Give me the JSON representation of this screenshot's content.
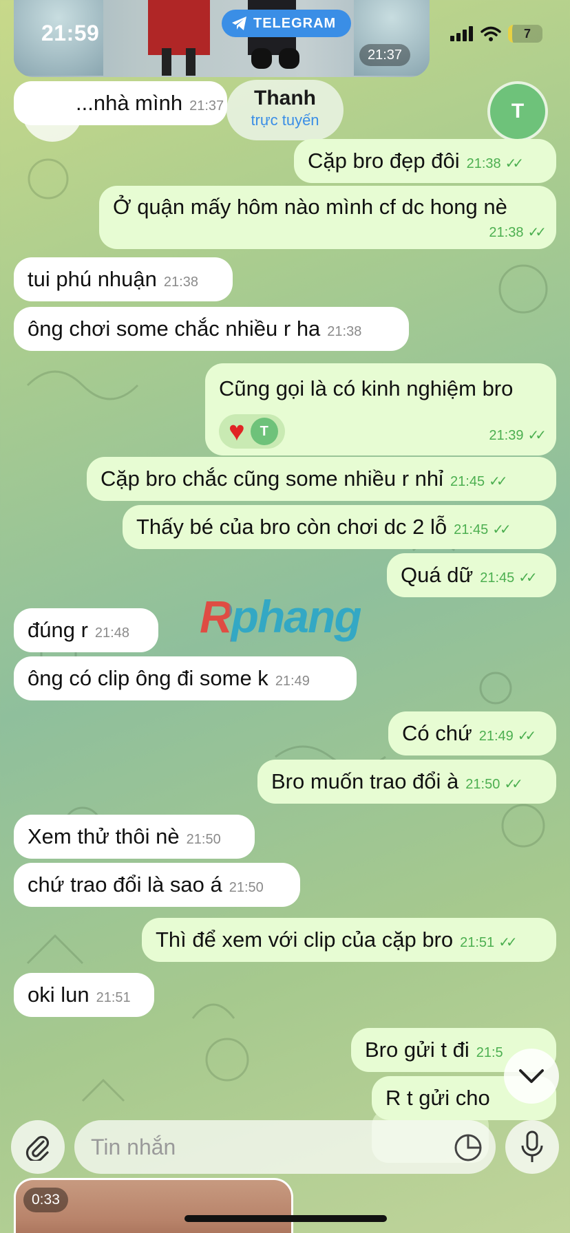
{
  "status_bar": {
    "time": "21:59",
    "app_pill": "TELEGRAM",
    "battery": "7"
  },
  "top_media": {
    "time": "21:37"
  },
  "header": {
    "name": "Thanh",
    "status": "trực tuyến",
    "avatar_initial": "T"
  },
  "messages": [
    {
      "dir": "in",
      "text": "...nhà mình",
      "time": "21:37"
    },
    {
      "dir": "out",
      "text": "Cặp bro đẹp đôi",
      "time": "21:38"
    },
    {
      "dir": "out",
      "text": "Ở quận mấy hôm nào mình cf dc hong nè",
      "time": "21:38"
    },
    {
      "dir": "in",
      "text": "tui phú nhuận",
      "time": "21:38"
    },
    {
      "dir": "in",
      "text": "ông chơi some chắc nhiều r ha",
      "time": "21:38"
    },
    {
      "dir": "out",
      "text": "Cũng gọi là có kinh nghiệm bro",
      "time": "21:39",
      "reaction_avatar": "T"
    },
    {
      "dir": "out",
      "text": "Cặp bro chắc cũng some nhiều r nhỉ",
      "time": "21:45"
    },
    {
      "dir": "out",
      "text": "Thấy bé của bro còn chơi dc 2 lỗ",
      "time": "21:45"
    },
    {
      "dir": "out",
      "text": "Quá dữ",
      "time": "21:45"
    },
    {
      "dir": "in",
      "text": "đúng r",
      "time": "21:48"
    },
    {
      "dir": "in",
      "text": "ông có clip ông đi some k",
      "time": "21:49"
    },
    {
      "dir": "out",
      "text": "Có chứ",
      "time": "21:49"
    },
    {
      "dir": "out",
      "text": "Bro muốn trao đổi à",
      "time": "21:50"
    },
    {
      "dir": "in",
      "text": "Xem thử thôi nè",
      "time": "21:50"
    },
    {
      "dir": "in",
      "text": "chứ trao đổi là sao á",
      "time": "21:50"
    },
    {
      "dir": "out",
      "text": "Thì để xem với clip của cặp bro",
      "time": "21:51"
    },
    {
      "dir": "in",
      "text": "oki lun",
      "time": "21:51"
    },
    {
      "dir": "out",
      "text": "Bro gửi t đi",
      "time": "21:5"
    },
    {
      "dir": "out",
      "text": "R t gửi cho",
      "time": ""
    }
  ],
  "watermark": "Rphang",
  "input": {
    "placeholder": "Tin nhắn"
  },
  "video": {
    "duration": "0:33"
  },
  "colors": {
    "incoming": "#ffffff",
    "outgoing": "#e7fcd3",
    "accent": "#3a8ee6",
    "tick": "#4caf50"
  },
  "icons": {
    "back": "chevron-left-icon",
    "attach": "paperclip-icon",
    "mic": "microphone-icon",
    "sticker": "sticker-icon",
    "scroll": "chevron-down-icon"
  }
}
